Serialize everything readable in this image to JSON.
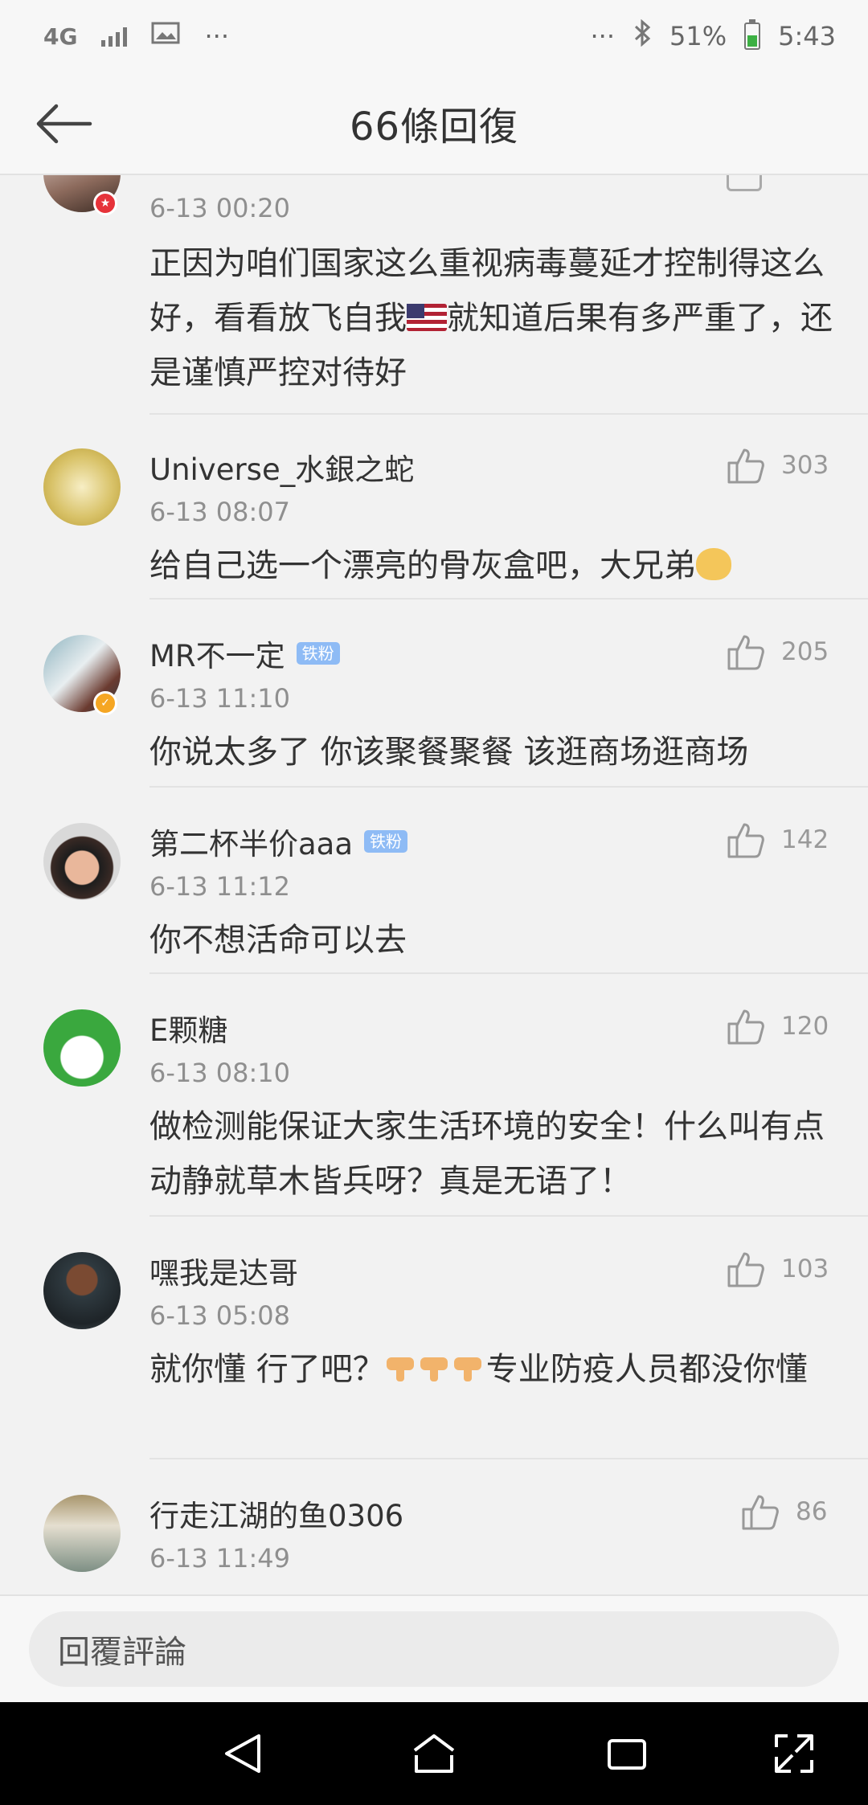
{
  "status_bar": {
    "network": "4G",
    "dots_left": "···",
    "dots_right": "···",
    "battery": "51%",
    "time": "5:43"
  },
  "header": {
    "title": "66條回復",
    "back_icon": "arrow-left-icon"
  },
  "comments": [
    {
      "timestamp": "6-13 00:20",
      "text_parts": [
        "正因为咱们国家这么重视病毒蔓延才控制得这么好，看看放飞自我",
        "就知道后果有多严重了，还是谨慎严控对待好"
      ],
      "text_emoji": "US flag"
    },
    {
      "username": "Universe_水銀之蛇",
      "likes": "303",
      "timestamp": "6-13 08:07",
      "text": "给自己选一个漂亮的骨灰盒吧，大兄弟"
    },
    {
      "username": "MR不一定",
      "badge": "铁粉",
      "likes": "205",
      "timestamp": "6-13 11:10",
      "text": "你说太多了 你该聚餐聚餐 该逛商场逛商场"
    },
    {
      "username": "第二杯半价aaa",
      "badge": "铁粉",
      "likes": "142",
      "timestamp": "6-13 11:12",
      "text": "你不想活命可以去"
    },
    {
      "username": "E颗糖",
      "likes": "120",
      "timestamp": "6-13 08:10",
      "text": "做检测能保证大家生活环境的安全！什么叫有点动静就草木皆兵呀？真是无语了！"
    },
    {
      "username": "嘿我是达哥",
      "likes": "103",
      "timestamp": "6-13 05:08",
      "text_before": "就你懂 行了吧？",
      "text_after": "专业防疫人员都没你懂"
    },
    {
      "username": "行走江湖的鱼0306",
      "likes": "86",
      "timestamp": "6-13 11:49"
    }
  ],
  "reply": {
    "placeholder": "回覆評論"
  },
  "colors": {
    "background": "#f2f2f2",
    "accent_badge": "#8ebbf5",
    "muted": "#8f8f8f"
  }
}
